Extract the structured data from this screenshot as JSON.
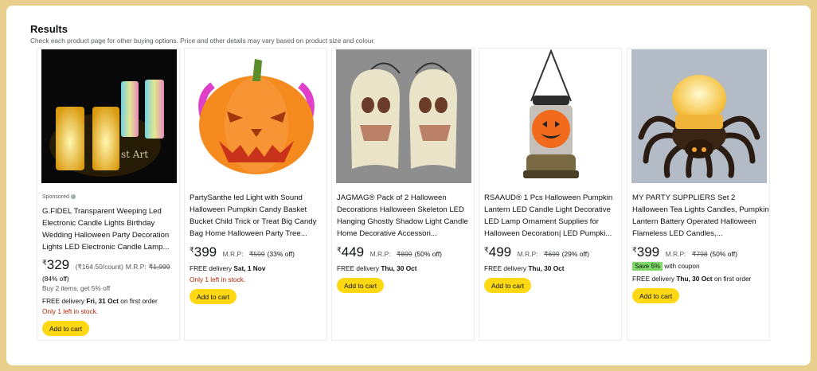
{
  "header": {
    "title": "Results",
    "subtitle": "Check each product page for other buying options. Price and other details may vary based on product size and colour."
  },
  "products": [
    {
      "sponsored": "Sponsored",
      "name": "G.FIDEL Transparent Weeping Led Electronic Candle Lights Birthday Wedding Halloween Party Decoration Lights LED Electronic Candle Lamp...",
      "currency": "₹",
      "price": "329",
      "unit": "(₹164.50/count)",
      "mrp_label": "M.R.P:",
      "mrp": "₹1,999",
      "discount": "(84% off)",
      "offer": "Buy 2 items, get 5% off",
      "delivery_prefix": "FREE delivery",
      "delivery_date": "Fri, 31 Oct",
      "delivery_suffix": "on first order",
      "stock": "Only 1 left in stock.",
      "button": "Add to cart"
    },
    {
      "name": "PartySanthe led Light with Sound Halloween Pumpkin Candy Basket Bucket Child Trick or Treat Big Candy Bag Home Halloween Party Tree...",
      "currency": "₹",
      "price": "399",
      "mrp_label": "M.R.P:",
      "mrp": "₹599",
      "discount": "(33% off)",
      "delivery_prefix": "FREE delivery",
      "delivery_date": "Sat, 1 Nov",
      "stock": "Only 1 left in stock.",
      "button": "Add to cart"
    },
    {
      "name": "JAGMAG® Pack of 2 Halloween Decorations Halloween Skeleton LED Hanging Ghostly Shadow Light Candle Home Decorative Accessori...",
      "currency": "₹",
      "price": "449",
      "mrp_label": "M.R.P:",
      "mrp": "₹899",
      "discount": "(50% off)",
      "delivery_prefix": "FREE delivery",
      "delivery_date": "Thu, 30 Oct",
      "button": "Add to cart"
    },
    {
      "name": "RSAAUD® 1 Pcs Halloween Pumpkin Lantern LED Candle Light Decorative LED Lamp Ornament Supplies for Halloween Decoration| LED Pumpki...",
      "currency": "₹",
      "price": "499",
      "mrp_label": "M.R.P:",
      "mrp": "₹699",
      "discount": "(29% off)",
      "delivery_prefix": "FREE delivery",
      "delivery_date": "Thu, 30 Oct",
      "button": "Add to cart"
    },
    {
      "name": "MY PARTY SUPPLIERS Set 2 Halloween Tea Lights Candles, Pumpkin Lantern Battery Operated Halloween Flameless LED Candles,...",
      "currency": "₹",
      "price": "399",
      "mrp_label": "M.R.P:",
      "mrp": "₹798",
      "discount": "(50% off)",
      "save_badge": "Save 5%",
      "coupon_text": "with coupon",
      "delivery_prefix": "FREE delivery",
      "delivery_date": "Thu, 30 Oct",
      "delivery_suffix": "on first order",
      "button": "Add to cart"
    }
  ]
}
